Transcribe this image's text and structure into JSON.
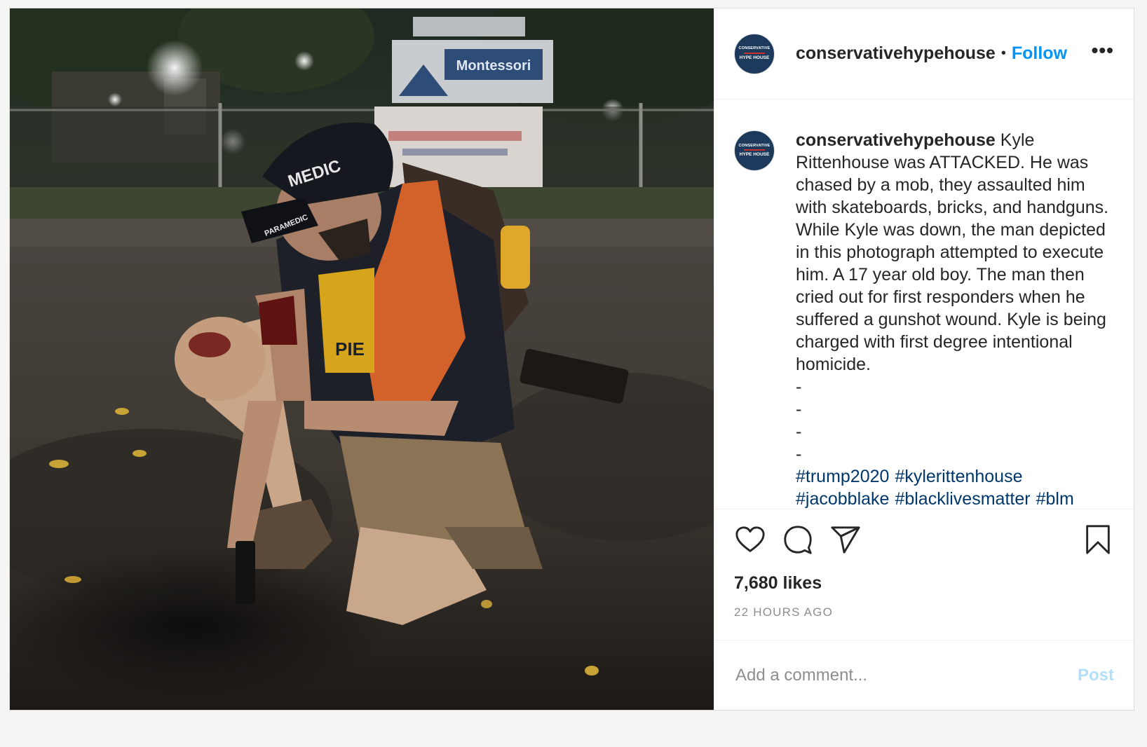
{
  "post": {
    "username": "conservativehypehouse",
    "follow_label": "Follow",
    "separator": "•",
    "more_label": "•••",
    "avatar": {
      "line1": "CONSERVATIVE",
      "line2": "HYPE HOUSE",
      "bg": "#1d3a5c"
    },
    "photo": {
      "sign_text": "Montessori",
      "cap_text": "MEDIC",
      "cap_text2": "PARAMEDIC",
      "shirt_text": "PIE"
    },
    "caption": {
      "username": "conservativehypehouse",
      "text": "Kyle Rittenhouse was ATTACKED. He was chased by a mob, they assaulted him with skateboards, bricks, and handguns. While Kyle was down, the man depicted in this photograph attempted to execute him. A 17 year old boy. The man then cried out for first responders when he suffered a gunshot wound. Kyle is being charged with first degree intentional homicide.",
      "dashes": [
        "-",
        "-",
        "-",
        "-"
      ],
      "hashtags": [
        "#trump2020",
        "#kylerittenhouse",
        "#jacobblake",
        "#blacklivesmatter",
        "#blm"
      ]
    },
    "likes": "7,680 likes",
    "timestamp": "22 HOURS AGO",
    "comment_box": {
      "placeholder": "Add a comment...",
      "post_label": "Post"
    },
    "colors": {
      "follow": "#0095f6",
      "hashtag": "#00376b",
      "post_disabled": "#b2dffc",
      "muted": "#8e8e8e"
    }
  }
}
